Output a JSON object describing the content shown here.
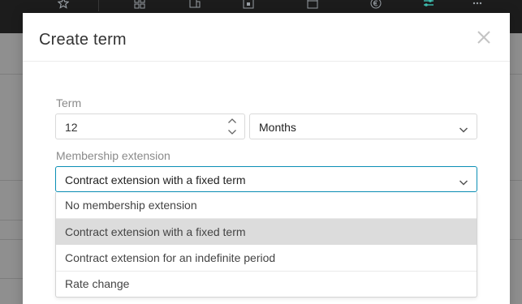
{
  "modal": {
    "title": "Create term",
    "close_icon": "close-icon"
  },
  "term": {
    "label": "Term",
    "value": "12",
    "unit_value": "Months"
  },
  "membership_extension": {
    "label": "Membership extension",
    "selected": "Contract extension with a fixed term",
    "options": [
      "No membership extension",
      "Contract extension with a fixed term",
      "Contract extension for an indefinite period",
      "Rate change"
    ],
    "highlighted_index": 1
  },
  "colors": {
    "focus_border": "#0a8fb5",
    "highlight_bg": "#dcdcdc",
    "topbar_bg": "#1c1c1c"
  },
  "topbar_icons": [
    "star-icon",
    "grid-icon",
    "devices-icon",
    "calendar-icon",
    "window-icon",
    "euro-icon",
    "sliders-icon",
    "more-icon"
  ]
}
